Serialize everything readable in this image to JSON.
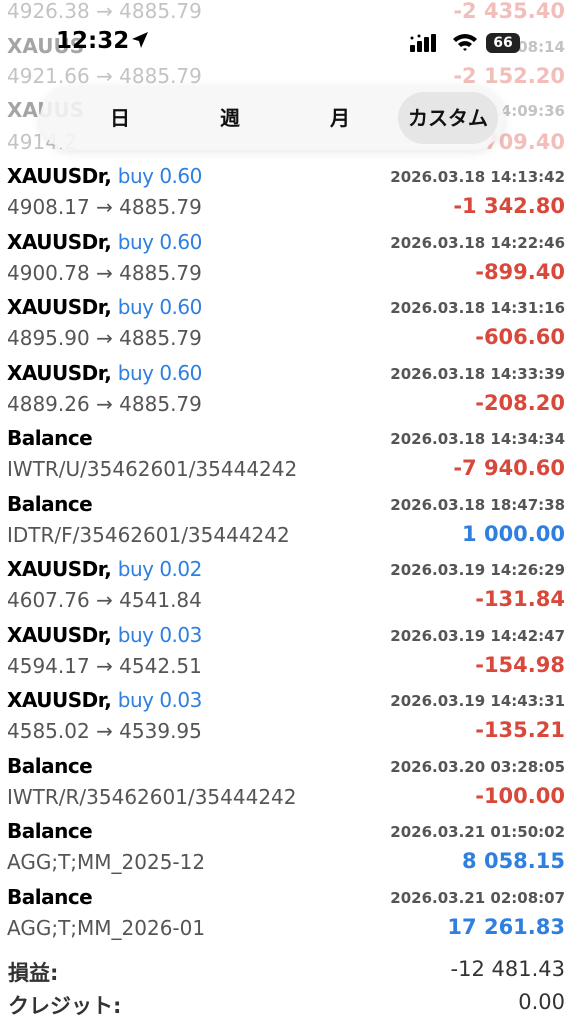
{
  "status_bar": {
    "time": "12:32",
    "battery": "66"
  },
  "period_tabs": [
    "日",
    "週",
    "月",
    "カスタム"
  ],
  "period_selected": "カスタム",
  "hidden_rows": [
    {
      "detail": "4926.38 → 4885.79",
      "amount": "-2 435.40"
    },
    {
      "symbol": "XAUUS",
      "time": "08:14"
    },
    {
      "detail": "4921.66 → 4885.79",
      "amount": "-2 152.20"
    },
    {
      "symbol": "XAUUS",
      "time": "14:09:36"
    },
    {
      "detail": "4914.2",
      "amount": "709.40"
    }
  ],
  "trades": [
    {
      "symbol": "XAUUSDr,",
      "action": "buy 0.60",
      "time": "2026.03.18 14:13:42",
      "detail": "4908.17 → 4885.79",
      "amount": "-1 342.80",
      "sign": "neg"
    },
    {
      "symbol": "XAUUSDr,",
      "action": "buy 0.60",
      "time": "2026.03.18 14:22:46",
      "detail": "4900.78 → 4885.79",
      "amount": "-899.40",
      "sign": "neg"
    },
    {
      "symbol": "XAUUSDr,",
      "action": "buy 0.60",
      "time": "2026.03.18 14:31:16",
      "detail": "4895.90 → 4885.79",
      "amount": "-606.60",
      "sign": "neg"
    },
    {
      "symbol": "XAUUSDr,",
      "action": "buy 0.60",
      "time": "2026.03.18 14:33:39",
      "detail": "4889.26 → 4885.79",
      "amount": "-208.20",
      "sign": "neg"
    },
    {
      "symbol": "Balance",
      "action": "",
      "time": "2026.03.18 14:34:34",
      "detail": "IWTR/U/35462601/35444242",
      "amount": "-7 940.60",
      "sign": "neg"
    },
    {
      "symbol": "Balance",
      "action": "",
      "time": "2026.03.18 18:47:38",
      "detail": "IDTR/F/35462601/35444242",
      "amount": "1 000.00",
      "sign": "pos"
    },
    {
      "symbol": "XAUUSDr,",
      "action": "buy 0.02",
      "time": "2026.03.19 14:26:29",
      "detail": "4607.76 → 4541.84",
      "amount": "-131.84",
      "sign": "neg"
    },
    {
      "symbol": "XAUUSDr,",
      "action": "buy 0.03",
      "time": "2026.03.19 14:42:47",
      "detail": "4594.17 → 4542.51",
      "amount": "-154.98",
      "sign": "neg"
    },
    {
      "symbol": "XAUUSDr,",
      "action": "buy 0.03",
      "time": "2026.03.19 14:43:31",
      "detail": "4585.02 → 4539.95",
      "amount": "-135.21",
      "sign": "neg"
    },
    {
      "symbol": "Balance",
      "action": "",
      "time": "2026.03.20 03:28:05",
      "detail": "IWTR/R/35462601/35444242",
      "amount": "-100.00",
      "sign": "neg"
    },
    {
      "symbol": "Balance",
      "action": "",
      "time": "2026.03.21 01:50:02",
      "detail": "AGG;T;MM_2025-12",
      "amount": "8 058.15",
      "sign": "pos"
    },
    {
      "symbol": "Balance",
      "action": "",
      "time": "2026.03.21 02:08:07",
      "detail": "AGG;T;MM_2026-01",
      "amount": "17 261.83",
      "sign": "pos"
    }
  ],
  "summary": [
    {
      "label": "損益:",
      "value": "-12 481.43"
    },
    {
      "label": "クレジット:",
      "value": "0.00"
    }
  ],
  "colors": {
    "negative": "#d8483b",
    "positive": "#2f7fe0",
    "action": "#2f7fe0"
  }
}
